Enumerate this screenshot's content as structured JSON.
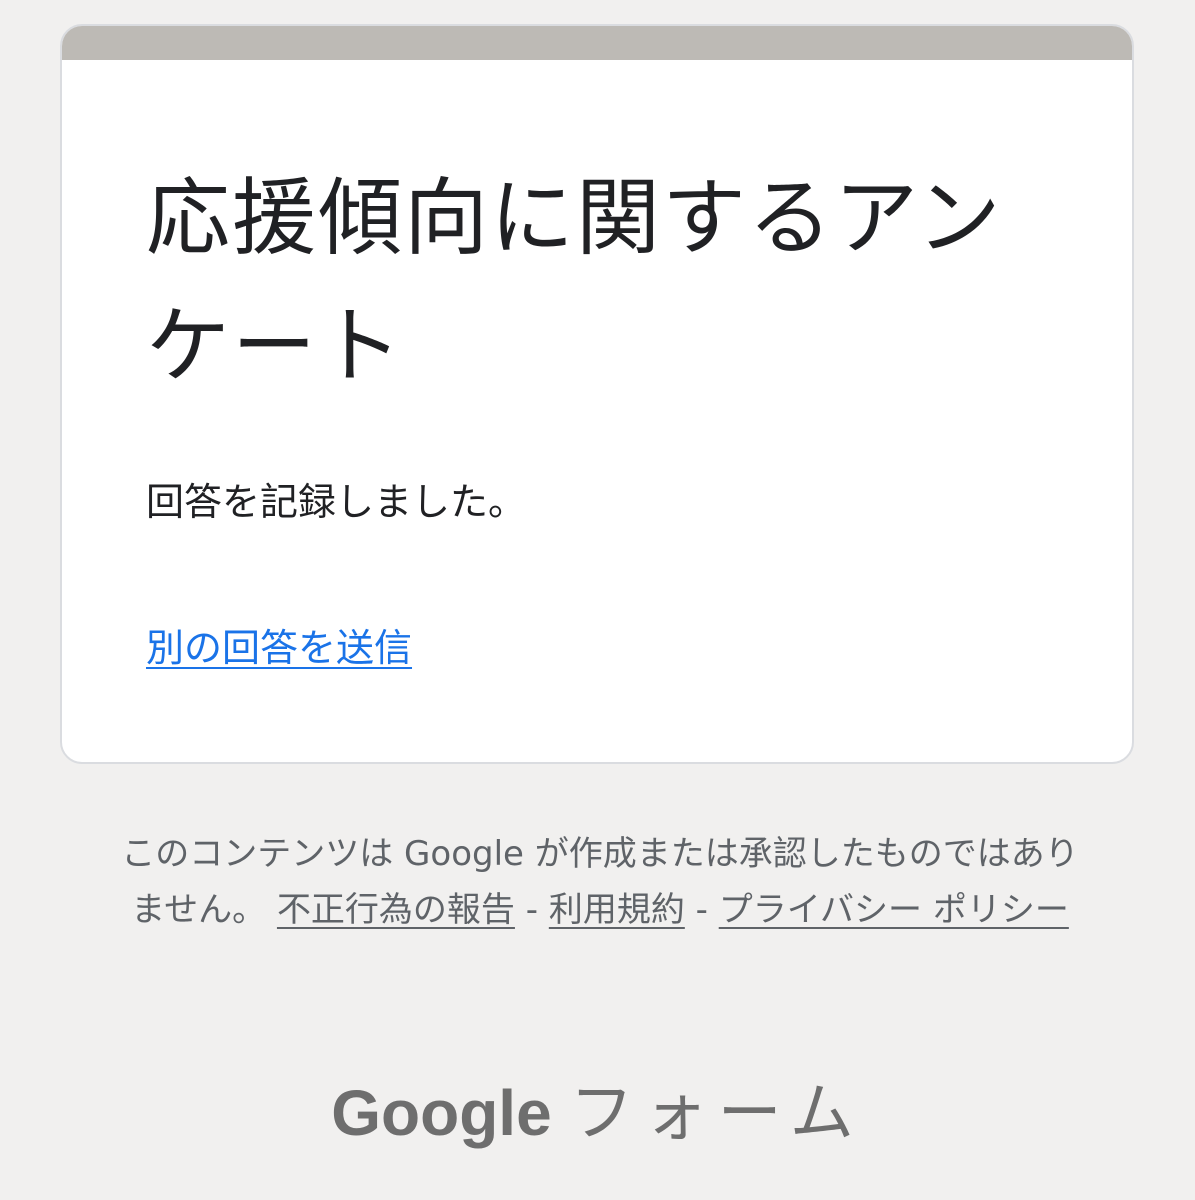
{
  "form": {
    "title": "応援傾向に関するアンケート",
    "confirmation": "回答を記録しました。",
    "another_response_link": "別の回答を送信"
  },
  "footer": {
    "disclaimer_text": "このコンテンツは Google が作成または承認したものではありません。",
    "report_abuse": "不正行為の報告",
    "separator": " - ",
    "terms": "利用規約",
    "privacy": "プライバシー ポリシー"
  },
  "brand": {
    "google": "Google",
    "forms": "フォーム"
  },
  "colors": {
    "page_background": "#f1f0ef",
    "card_accent": "#bdbab5",
    "link": "#1a73e8",
    "footer_text": "#5f6368"
  }
}
